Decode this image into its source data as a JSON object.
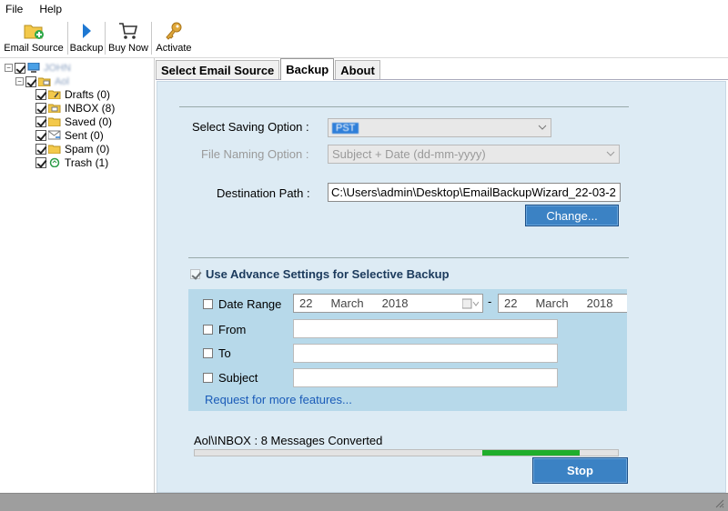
{
  "menubar": {
    "items": [
      "File",
      "Help"
    ]
  },
  "toolbar": {
    "email_source": "Email Source",
    "backup": "Backup",
    "buy_now": "Buy Now",
    "activate": "Activate"
  },
  "tree": {
    "root_label": "JOHN",
    "account_label": "Aol",
    "folders": [
      {
        "label": "Drafts (0)"
      },
      {
        "label": "INBOX (8)"
      },
      {
        "label": "Saved (0)"
      },
      {
        "label": "Sent (0)"
      },
      {
        "label": "Spam (0)"
      },
      {
        "label": "Trash (1)"
      }
    ]
  },
  "tabs": {
    "select_email_source": "Select Email Source",
    "backup": "Backup",
    "about": "About"
  },
  "backup": {
    "saving_option_label": "Select Saving Option  :",
    "saving_option_value": "PST",
    "file_naming_label": "File Naming Option  :",
    "file_naming_value": "Subject + Date (dd-mm-yyyy)",
    "destination_label": "Destination Path  :",
    "destination_value": "C:\\Users\\admin\\Desktop\\EmailBackupWizard_22-03-2",
    "change_button": "Change...",
    "advance_settings_label": "Use Advance Settings for Selective Backup",
    "date_range_label": "Date Range",
    "date_from": {
      "day": "22",
      "month": "March",
      "year": "2018"
    },
    "date_separator": "-",
    "date_to": {
      "day": "22",
      "month": "March",
      "year": "2018"
    },
    "from_label": "From",
    "to_label": "To",
    "subject_label": "Subject",
    "request_link": "Request for more features...",
    "status_text": "Aol\\INBOX : 8 Messages Converted",
    "progress_fill_start": 0.68,
    "progress_fill_end": 0.91,
    "stop_button": "Stop"
  },
  "colors": {
    "panel_bg": "#ddebf4",
    "adv_box_bg": "#b7d9ea",
    "button_blue": "#3b82c4",
    "progress_green": "#1fae2c",
    "link_blue": "#1a5bb8",
    "statusbar_gray": "#9e9e9e"
  }
}
